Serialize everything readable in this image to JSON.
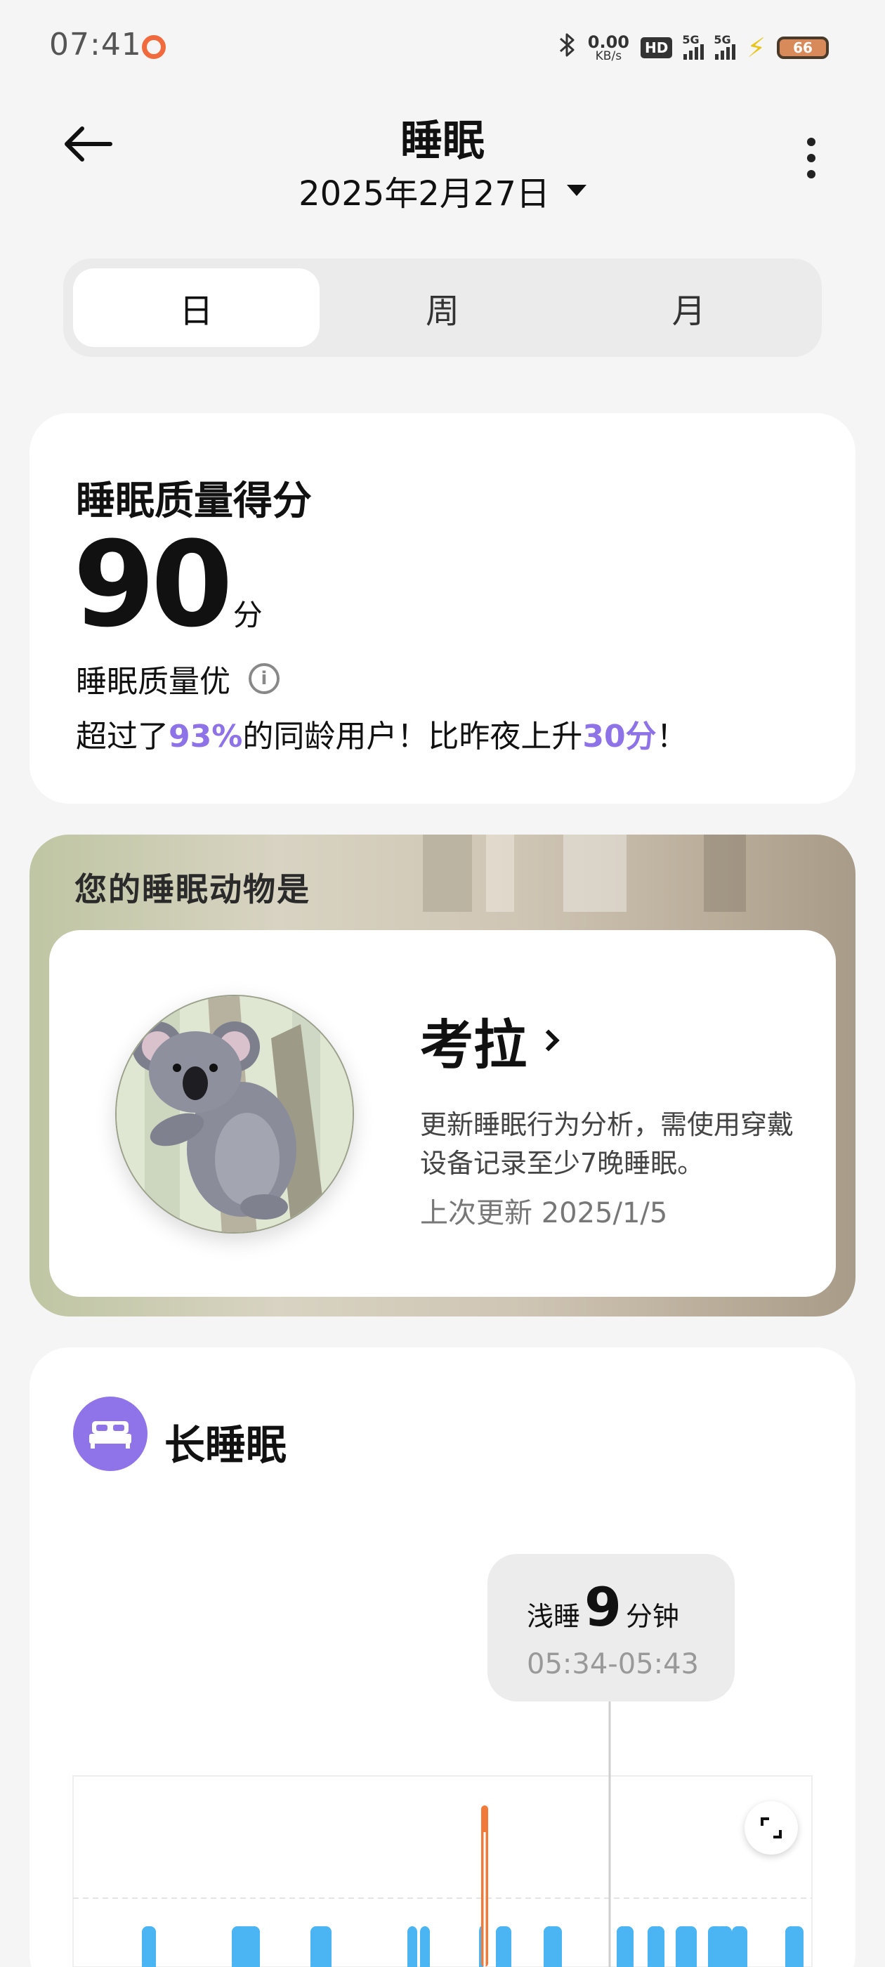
{
  "status_bar": {
    "time": "07:41",
    "net_speed_value": "0.00",
    "net_speed_unit": "KB/s",
    "hd_label": "HD",
    "signal_1_label": "5G",
    "signal_2_label": "5G",
    "battery_level": "66",
    "icons": [
      "bluetooth-icon",
      "hd-voice-icon",
      "signal-5g-icon",
      "charging-bolt-icon",
      "battery-icon"
    ]
  },
  "header": {
    "title": "睡眠",
    "date": "2025年2月27日"
  },
  "tabs": [
    {
      "label": "日",
      "active": true
    },
    {
      "label": "周",
      "active": false
    },
    {
      "label": "月",
      "active": false
    }
  ],
  "score_card": {
    "title": "睡眠质量得分",
    "score": "90",
    "unit": "分",
    "quality": "睡眠质量优",
    "compare_prefix": "超过了",
    "compare_percent": "93%",
    "compare_middle": "的同龄用户！比昨夜上升",
    "compare_points": "30分",
    "compare_suffix": "！",
    "highlight_color": "#8e72e8"
  },
  "animal_card": {
    "label": "您的睡眠动物是",
    "name": "考拉",
    "description": "更新睡眠行为分析，需使用穿戴设备记录至少7晚睡眠。",
    "last_update": "上次更新 2025/1/5"
  },
  "long_sleep": {
    "title": "长睡眠",
    "icon_color": "#8f73e8",
    "tooltip": {
      "stage": "浅睡",
      "minutes": "9",
      "unit": "分钟",
      "time_range": "05:34-05:43"
    },
    "colors": {
      "light": "#4ab5f2",
      "awake": "#f07a3a"
    }
  }
}
